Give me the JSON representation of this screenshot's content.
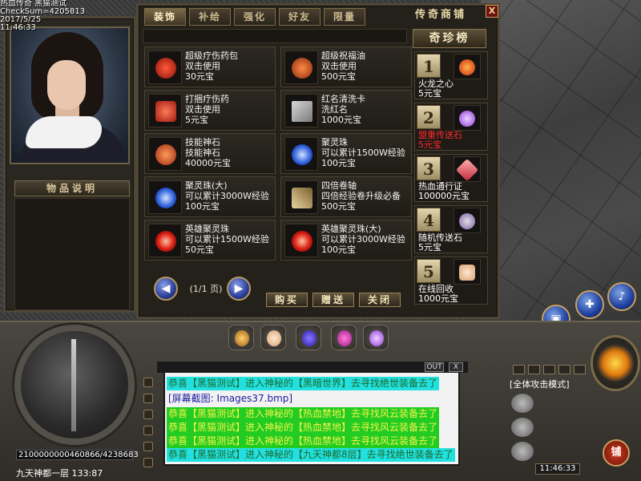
{
  "system": {
    "window_title": "热血传奇 黑猫测试",
    "checksum": "CheckSum=4205813",
    "date": "2017/5/25",
    "time": "11:46:33"
  },
  "left_panel": {
    "item_desc_title": "物品说明"
  },
  "shop": {
    "title": "传奇商铺",
    "close_label": "X",
    "tabs": [
      "装饰",
      "补给",
      "强化",
      "好友",
      "限量"
    ],
    "active_tab": "装饰",
    "items": [
      {
        "lines": [
          "超级疗伤药包",
          "双击使用",
          "30元宝"
        ],
        "icon": "red-potion-bag-icon"
      },
      {
        "lines": [
          "超级祝福油",
          "双击使用",
          "500元宝"
        ],
        "icon": "blessing-oil-icon"
      },
      {
        "lines": [
          "打捆疗伤药",
          "双击使用",
          "5元宝"
        ],
        "icon": "potion-bundle-icon"
      },
      {
        "lines": [
          "红名清洗卡",
          "洗红名",
          "1000元宝"
        ],
        "icon": "card-icon"
      },
      {
        "lines": [
          "技能神石",
          "技能神石",
          "40000元宝"
        ],
        "icon": "skill-stone-icon"
      },
      {
        "lines": [
          "聚灵珠",
          "可以累计1500W经验",
          "100元宝"
        ],
        "icon": "blue-orb-icon"
      },
      {
        "lines": [
          "聚灵珠(大)",
          "可以累计3000W经验",
          "100元宝"
        ],
        "icon": "blue-orb-large-icon"
      },
      {
        "lines": [
          "四倍卷轴",
          "四倍经验卷升级必备",
          "500元宝"
        ],
        "icon": "scroll-icon"
      },
      {
        "lines": [
          "英雄聚灵珠",
          "可以累计1500W经验",
          "50元宝"
        ],
        "icon": "red-orb-icon"
      },
      {
        "lines": [
          "英雄聚灵珠(大)",
          "可以累计3000W经验",
          "100元宝"
        ],
        "icon": "red-orb-large-icon"
      }
    ],
    "page_indicator": "(1/1 页)",
    "prev_label": "◀",
    "next_label": "▶",
    "buy_label": "购买",
    "gift_label": "赠送",
    "close_button_label": "关闭"
  },
  "rare_list": {
    "title": "奇珍榜",
    "entries": [
      {
        "rank": "1",
        "name": "火龙之心",
        "price": "5元宝",
        "name_color": "#ffffff",
        "icon": "fire-dragon-heart-icon"
      },
      {
        "rank": "2",
        "name": "盟重传送石",
        "price": "5元宝",
        "name_color": "#ff2a2a",
        "icon": "teleport-stone-icon"
      },
      {
        "rank": "3",
        "name": "热血通行证",
        "price": "100000元宝",
        "name_color": "#ffffff",
        "icon": "pass-crystal-icon"
      },
      {
        "rank": "4",
        "name": "随机传送石",
        "price": "5元宝",
        "name_color": "#ffffff",
        "icon": "random-stone-icon"
      },
      {
        "rank": "5",
        "name": "在线回收",
        "price": "1000元宝",
        "name_color": "#ffffff",
        "icon": "hand-icon"
      }
    ]
  },
  "chat": {
    "out_label": "OUT",
    "close_label": "X",
    "lines": [
      {
        "text": "恭喜【黑猫测试】进入神秘的【黑暗世界】去寻找绝世装备去了",
        "bg": "#22e0e0",
        "color": "#1a6a2a"
      },
      {
        "text": "[屏幕截图: Images37.bmp]",
        "bg": "#f2f2f2",
        "color": "#1a1aa0"
      },
      {
        "text": "恭喜【黑猫测试】进入神秘的【热血禁地】去寻找风云装备去了",
        "bg": "#22cc22",
        "color": "#f2f24a"
      },
      {
        "text": "恭喜【黑猫测试】进入神秘的【热血禁地】去寻找风云装备去了",
        "bg": "#22cc22",
        "color": "#f2f24a"
      },
      {
        "text": "恭喜【黑猫测试】进入神秘的【热血禁地】去寻找风云装备去了",
        "bg": "#22cc22",
        "color": "#f2f24a"
      },
      {
        "text": "恭喜【黑猫测试】进入神秘的【九天神都8层】去寻找绝世装备去了",
        "bg": "#22e0e0",
        "color": "#1a6a2a"
      }
    ]
  },
  "status": {
    "hp_mp": "2100000000460866/4238683",
    "map_location": "九天神都一层 133:87",
    "attack_mode": "[全体攻击模式]",
    "clock": "11:46:33",
    "shop_button": "铺"
  }
}
